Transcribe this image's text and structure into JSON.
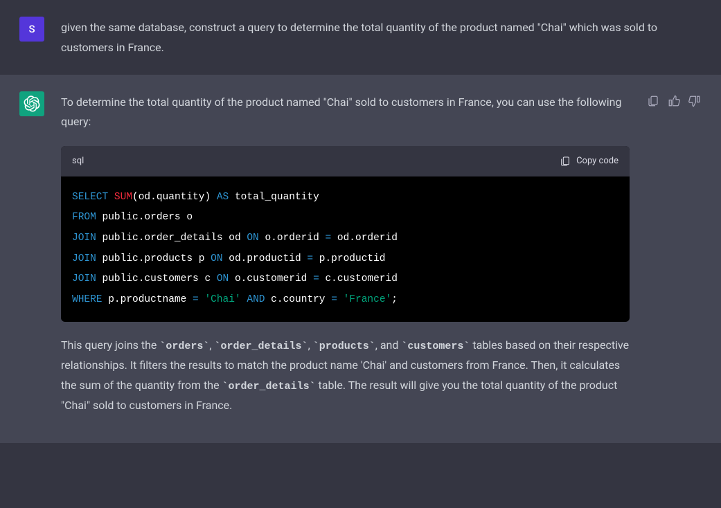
{
  "user": {
    "avatar_letter": "S",
    "message": "given the same database, construct a query to determine the total quantity of the product named \"Chai\" which was sold to customers in France."
  },
  "assistant": {
    "intro": "To determine the total quantity of the product named \"Chai\" sold to customers in France, you can use the following query:",
    "code_lang": "sql",
    "copy_label": "Copy code",
    "code": {
      "l1": {
        "a": "SELECT",
        "b": "SUM",
        "c": "(od.quantity) ",
        "d": "AS",
        "e": " total_quantity"
      },
      "l2": {
        "a": "FROM",
        "b": " public.orders o"
      },
      "l3": {
        "a": "JOIN",
        "b": " public.order_details od ",
        "c": "ON",
        "d": " o.orderid ",
        "e": "=",
        "f": " od.orderid"
      },
      "l4": {
        "a": "JOIN",
        "b": " public.products p ",
        "c": "ON",
        "d": " od.productid ",
        "e": "=",
        "f": " p.productid"
      },
      "l5": {
        "a": "JOIN",
        "b": " public.customers c ",
        "c": "ON",
        "d": " o.customerid ",
        "e": "=",
        "f": " c.customerid"
      },
      "l6": {
        "a": "WHERE",
        "b": " p.productname ",
        "c": "=",
        "d": " ",
        "e": "'Chai'",
        "f": " ",
        "g": "AND",
        "h": " c.country ",
        "i": "=",
        "j": " ",
        "k": "'France'",
        "l": ";"
      }
    },
    "explain": {
      "p1": "This query joins the ",
      "c1": "`orders`",
      "p2": ", ",
      "c2": "`order_details`",
      "p3": ", ",
      "c3": "`products`",
      "p4": ", and ",
      "c4": "`customers`",
      "p5": " tables based on their respective relationships. It filters the results to match the product name 'Chai' and customers from France. Then, it calculates the sum of the quantity from the ",
      "c5": "`order_details`",
      "p6": " table. The result will give you the total quantity of the product \"Chai\" sold to customers in France."
    }
  }
}
